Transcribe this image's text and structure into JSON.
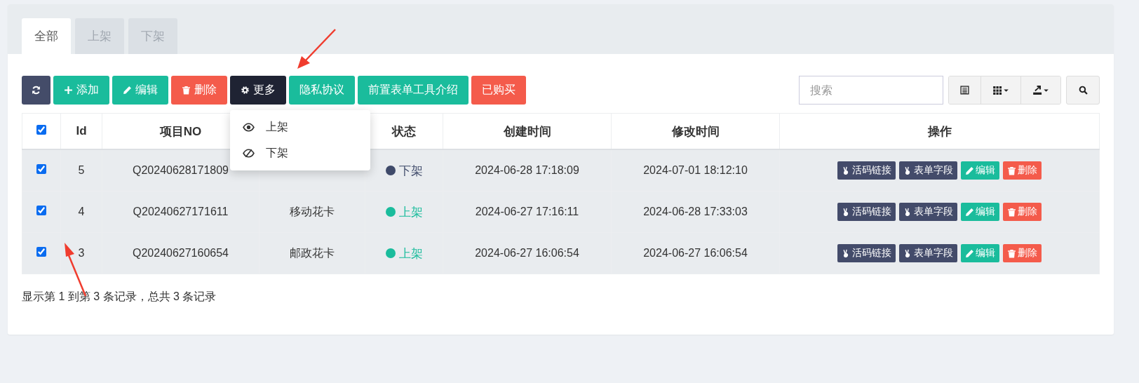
{
  "tabs": [
    {
      "label": "全部",
      "selected": true
    },
    {
      "label": "上架",
      "selected": false
    },
    {
      "label": "下架",
      "selected": false
    }
  ],
  "toolbar": {
    "buttons": [
      {
        "kind": "add",
        "label": "添加"
      },
      {
        "kind": "edit",
        "label": "编辑"
      },
      {
        "kind": "delete",
        "label": "删除"
      },
      {
        "kind": "more",
        "label": "更多",
        "expanded": true,
        "menu": [
          {
            "kind": "show",
            "label": "上架"
          },
          {
            "kind": "hide",
            "label": "下架"
          }
        ]
      },
      {
        "kind": "plain",
        "label": "隐私协议"
      },
      {
        "kind": "plain",
        "label": "前置表单工具介绍"
      },
      {
        "kind": "danger",
        "label": "已购买"
      }
    ],
    "search": {
      "placeholder": "搜索"
    }
  },
  "table": {
    "all_checked": true,
    "columns": [
      "Id",
      "项目NO",
      "状态",
      "创建时间",
      "修改时间",
      "操作"
    ],
    "rows": [
      {
        "checked": true,
        "id": "5",
        "no": "Q20240628171809",
        "status": {
          "label": "下架",
          "listed": false
        },
        "created": "2024-06-28 17:18:09",
        "modified": "2024-07-01 18:12:10",
        "actions": [
          {
            "kind": "link",
            "label": "活码链接"
          },
          {
            "kind": "field",
            "label": "表单字段"
          },
          {
            "kind": "edit",
            "label": "编辑"
          },
          {
            "kind": "delete",
            "label": "删除"
          }
        ]
      },
      {
        "checked": true,
        "id": "4",
        "no": "Q20240627171611",
        "name": "移动花卡",
        "status": {
          "label": "上架",
          "listed": true
        },
        "created": "2024-06-27 17:16:11",
        "modified": "2024-06-28 17:33:03",
        "actions": [
          {
            "kind": "link",
            "label": "活码链接"
          },
          {
            "kind": "field",
            "label": "表单字段"
          },
          {
            "kind": "edit",
            "label": "编辑"
          },
          {
            "kind": "delete",
            "label": "删除"
          }
        ]
      },
      {
        "checked": true,
        "id": "3",
        "no": "Q20240627160654",
        "name": "邮政花卡",
        "status": {
          "label": "上架",
          "listed": true
        },
        "created": "2024-06-27 16:06:54",
        "modified": "2024-06-27 16:06:54",
        "actions": [
          {
            "kind": "link",
            "label": "活码链接"
          },
          {
            "kind": "field",
            "label": "表单字段"
          },
          {
            "kind": "edit",
            "label": "编辑"
          },
          {
            "kind": "delete",
            "label": "删除"
          }
        ]
      }
    ]
  },
  "footer": "显示第 1 到第 3 条记录，总共 3 条记录"
}
